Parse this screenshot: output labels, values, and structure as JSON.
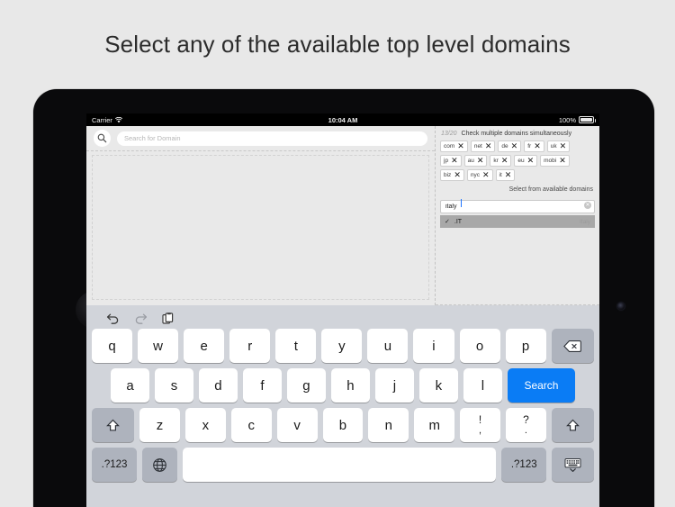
{
  "caption": "Select any of the available top level domains",
  "device": {
    "home_button": "home-button",
    "camera": "front-camera"
  },
  "status_bar": {
    "carrier": "Carrier",
    "wifi_icon": "wifi-icon",
    "time": "10:04 AM",
    "battery_percent": "100%",
    "battery_icon": "battery-full-icon"
  },
  "search": {
    "icon": "search-icon",
    "value": "",
    "placeholder": "Search for Domain"
  },
  "tld_panel": {
    "count": "13/20",
    "title": "Check multiple domains simultaneously",
    "available_label": "Select from available domains",
    "chips": [
      [
        {
          "label": "com",
          "remove": "✕"
        },
        {
          "label": "net",
          "remove": "✕"
        },
        {
          "label": "de",
          "remove": "✕"
        },
        {
          "label": "fr",
          "remove": "✕"
        },
        {
          "label": "uk",
          "remove": "✕"
        }
      ],
      [
        {
          "label": "jp",
          "remove": "✕"
        },
        {
          "label": "au",
          "remove": "✕"
        },
        {
          "label": "kr",
          "remove": "✕"
        },
        {
          "label": "eu",
          "remove": "✕"
        },
        {
          "label": "mobi",
          "remove": "✕"
        }
      ],
      [
        {
          "label": "biz",
          "remove": "✕"
        },
        {
          "label": "nyc",
          "remove": "✕"
        },
        {
          "label": "it",
          "remove": "✕"
        }
      ]
    ],
    "filter": {
      "value": "italy",
      "clear_icon": "clear-icon",
      "clear_glyph": "✕"
    },
    "results": [
      {
        "check": "✓",
        "code": ".IT",
        "country": "Italy"
      }
    ]
  },
  "keyboard": {
    "toolbar": {
      "undo_icon": "undo-icon",
      "redo_icon": "redo-icon",
      "paste_icon": "paste-icon"
    },
    "row1": [
      "q",
      "w",
      "e",
      "r",
      "t",
      "y",
      "u",
      "i",
      "o",
      "p"
    ],
    "backspace_icon": "backspace-icon",
    "row2": [
      "a",
      "s",
      "d",
      "f",
      "g",
      "h",
      "j",
      "k",
      "l"
    ],
    "search_key": "Search",
    "shift_icon": "shift-icon",
    "row3": [
      "z",
      "x",
      "c",
      "v",
      "b",
      "n",
      "m"
    ],
    "punct1": {
      "top": "!",
      "bottom": ","
    },
    "punct2": {
      "top": "?",
      "bottom": "."
    },
    "numeric_key": ".?123",
    "globe_icon": "globe-icon",
    "space_key": "",
    "numeric_key_right": ".?123",
    "hide_keyboard_icon": "hide-keyboard-icon"
  },
  "colors": {
    "page_bg": "#e8e8e8",
    "accent_blue": "#0a7cf5",
    "keyboard_bg": "#d1d4da",
    "key_dark": "#aeb3bd",
    "row_selected": "#a8a8a8"
  }
}
